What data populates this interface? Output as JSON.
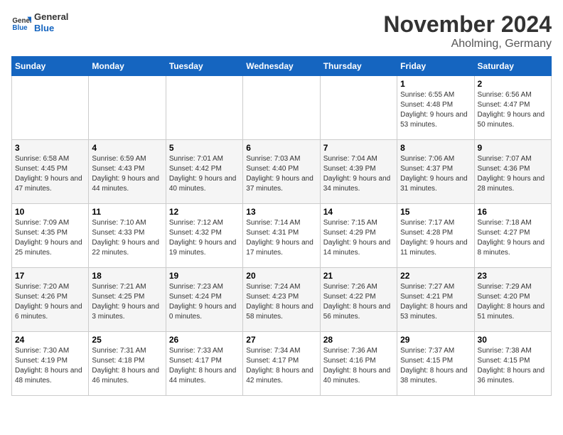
{
  "logo": {
    "text_general": "General",
    "text_blue": "Blue"
  },
  "title": "November 2024",
  "subtitle": "Aholming, Germany",
  "days_of_week": [
    "Sunday",
    "Monday",
    "Tuesday",
    "Wednesday",
    "Thursday",
    "Friday",
    "Saturday"
  ],
  "weeks": [
    [
      {
        "day": "",
        "info": ""
      },
      {
        "day": "",
        "info": ""
      },
      {
        "day": "",
        "info": ""
      },
      {
        "day": "",
        "info": ""
      },
      {
        "day": "",
        "info": ""
      },
      {
        "day": "1",
        "info": "Sunrise: 6:55 AM\nSunset: 4:48 PM\nDaylight: 9 hours and 53 minutes."
      },
      {
        "day": "2",
        "info": "Sunrise: 6:56 AM\nSunset: 4:47 PM\nDaylight: 9 hours and 50 minutes."
      }
    ],
    [
      {
        "day": "3",
        "info": "Sunrise: 6:58 AM\nSunset: 4:45 PM\nDaylight: 9 hours and 47 minutes."
      },
      {
        "day": "4",
        "info": "Sunrise: 6:59 AM\nSunset: 4:43 PM\nDaylight: 9 hours and 44 minutes."
      },
      {
        "day": "5",
        "info": "Sunrise: 7:01 AM\nSunset: 4:42 PM\nDaylight: 9 hours and 40 minutes."
      },
      {
        "day": "6",
        "info": "Sunrise: 7:03 AM\nSunset: 4:40 PM\nDaylight: 9 hours and 37 minutes."
      },
      {
        "day": "7",
        "info": "Sunrise: 7:04 AM\nSunset: 4:39 PM\nDaylight: 9 hours and 34 minutes."
      },
      {
        "day": "8",
        "info": "Sunrise: 7:06 AM\nSunset: 4:37 PM\nDaylight: 9 hours and 31 minutes."
      },
      {
        "day": "9",
        "info": "Sunrise: 7:07 AM\nSunset: 4:36 PM\nDaylight: 9 hours and 28 minutes."
      }
    ],
    [
      {
        "day": "10",
        "info": "Sunrise: 7:09 AM\nSunset: 4:35 PM\nDaylight: 9 hours and 25 minutes."
      },
      {
        "day": "11",
        "info": "Sunrise: 7:10 AM\nSunset: 4:33 PM\nDaylight: 9 hours and 22 minutes."
      },
      {
        "day": "12",
        "info": "Sunrise: 7:12 AM\nSunset: 4:32 PM\nDaylight: 9 hours and 19 minutes."
      },
      {
        "day": "13",
        "info": "Sunrise: 7:14 AM\nSunset: 4:31 PM\nDaylight: 9 hours and 17 minutes."
      },
      {
        "day": "14",
        "info": "Sunrise: 7:15 AM\nSunset: 4:29 PM\nDaylight: 9 hours and 14 minutes."
      },
      {
        "day": "15",
        "info": "Sunrise: 7:17 AM\nSunset: 4:28 PM\nDaylight: 9 hours and 11 minutes."
      },
      {
        "day": "16",
        "info": "Sunrise: 7:18 AM\nSunset: 4:27 PM\nDaylight: 9 hours and 8 minutes."
      }
    ],
    [
      {
        "day": "17",
        "info": "Sunrise: 7:20 AM\nSunset: 4:26 PM\nDaylight: 9 hours and 6 minutes."
      },
      {
        "day": "18",
        "info": "Sunrise: 7:21 AM\nSunset: 4:25 PM\nDaylight: 9 hours and 3 minutes."
      },
      {
        "day": "19",
        "info": "Sunrise: 7:23 AM\nSunset: 4:24 PM\nDaylight: 9 hours and 0 minutes."
      },
      {
        "day": "20",
        "info": "Sunrise: 7:24 AM\nSunset: 4:23 PM\nDaylight: 8 hours and 58 minutes."
      },
      {
        "day": "21",
        "info": "Sunrise: 7:26 AM\nSunset: 4:22 PM\nDaylight: 8 hours and 56 minutes."
      },
      {
        "day": "22",
        "info": "Sunrise: 7:27 AM\nSunset: 4:21 PM\nDaylight: 8 hours and 53 minutes."
      },
      {
        "day": "23",
        "info": "Sunrise: 7:29 AM\nSunset: 4:20 PM\nDaylight: 8 hours and 51 minutes."
      }
    ],
    [
      {
        "day": "24",
        "info": "Sunrise: 7:30 AM\nSunset: 4:19 PM\nDaylight: 8 hours and 48 minutes."
      },
      {
        "day": "25",
        "info": "Sunrise: 7:31 AM\nSunset: 4:18 PM\nDaylight: 8 hours and 46 minutes."
      },
      {
        "day": "26",
        "info": "Sunrise: 7:33 AM\nSunset: 4:17 PM\nDaylight: 8 hours and 44 minutes."
      },
      {
        "day": "27",
        "info": "Sunrise: 7:34 AM\nSunset: 4:17 PM\nDaylight: 8 hours and 42 minutes."
      },
      {
        "day": "28",
        "info": "Sunrise: 7:36 AM\nSunset: 4:16 PM\nDaylight: 8 hours and 40 minutes."
      },
      {
        "day": "29",
        "info": "Sunrise: 7:37 AM\nSunset: 4:15 PM\nDaylight: 8 hours and 38 minutes."
      },
      {
        "day": "30",
        "info": "Sunrise: 7:38 AM\nSunset: 4:15 PM\nDaylight: 8 hours and 36 minutes."
      }
    ]
  ]
}
